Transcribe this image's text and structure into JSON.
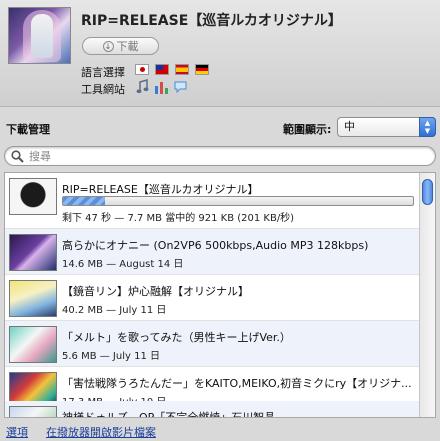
{
  "video": {
    "title": "RIP=RELEASE【巡音ルカオリジナル】",
    "download_label": "下載",
    "language_label": "語言選擇",
    "languages": [
      "jp-flag-icon",
      "tw-flag-icon",
      "es-flag-icon",
      "de-flag-icon"
    ],
    "tools_label": "工具網站"
  },
  "manager": {
    "title": "下載管理",
    "range_label": "範圍顯示:",
    "range_value": "中"
  },
  "search": {
    "placeholder": "搜尋"
  },
  "downloads": [
    {
      "title": "RIP=RELEASE【巡音ルカオリジナル】",
      "progress": 0.12,
      "status": "剩下 47 秒 — 7.7 MB 當中的 921 KB (201 KB/秒)"
    },
    {
      "title": "高らかにオナニー (On2VP6 500kbps,Audio MP3 128kbps)",
      "status": "14.6 MB — August 14 日"
    },
    {
      "title": "【鏡音リン】炉心融解【オリジナル】",
      "status": "40.2 MB — July 11 日"
    },
    {
      "title": "「メルト」を歌ってみた（男性キー上げVer.）",
      "status": "5.6 MB — July 11 日"
    },
    {
      "title": "「害怯戦隊うろたんだー」をKAITO,MEIKO,初音ミクにry【オリジナ...",
      "status": "17.3 MB — July 10 日"
    },
    {
      "title": "神様ドォルズ　OP「不完全燃焼」石川智晶",
      "status": ""
    }
  ],
  "footer": {
    "options_label": "選項",
    "open_player_label": "在撥放器開啟影片檔案"
  },
  "colors": {
    "accent": "#3f7fe0",
    "link": "#1c3f9a",
    "header_bg": "#dcdcdc"
  }
}
